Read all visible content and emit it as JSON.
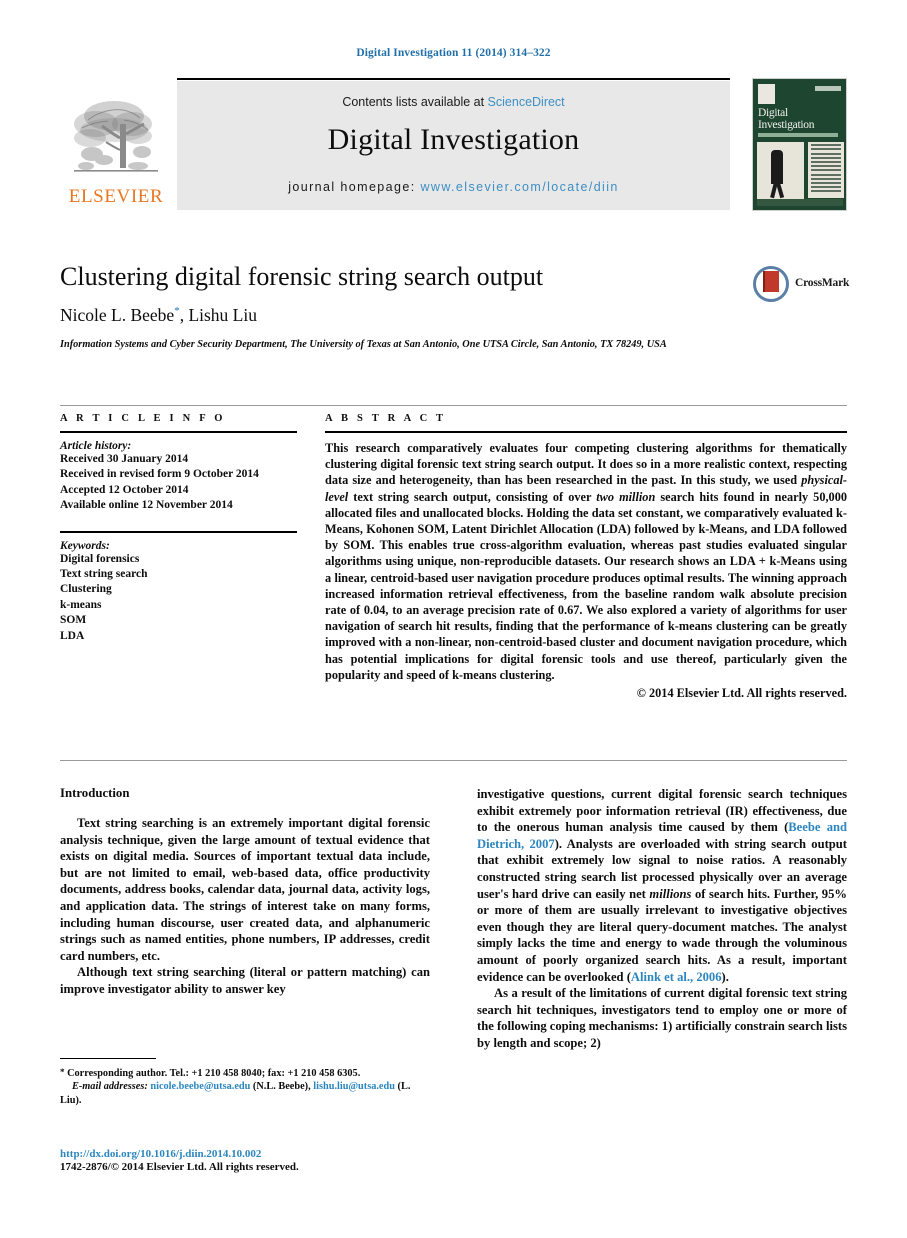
{
  "running_head": "Digital Investigation 11 (2014) 314–322",
  "masthead": {
    "contents_prefix": "Contents lists available at ",
    "sciencedirect": "ScienceDirect",
    "journal_title": "Digital Investigation",
    "homepage_prefix": "journal homepage: ",
    "homepage_url": "www.elsevier.com/locate/diin",
    "publisher": "ELSEVIER",
    "cover_title": "Digital Investigation"
  },
  "article": {
    "title": "Clustering digital forensic string search output",
    "authors": "Nicole L. Beebe",
    "author_marker": "*",
    "authors_rest": ", Lishu Liu",
    "affiliation": "Information Systems and Cyber Security Department, The University of Texas at San Antonio, One UTSA Circle, San Antonio, TX 78249, USA",
    "crossmark_label": "CrossMark"
  },
  "info": {
    "heading": "A R T I C L E   I N F O",
    "history_label": "Article history:",
    "history": [
      "Received 30 January 2014",
      "Received in revised form 9 October 2014",
      "Accepted 12 October 2014",
      "Available online 12 November 2014"
    ],
    "keywords_label": "Keywords:",
    "keywords": [
      "Digital forensics",
      "Text string search",
      "Clustering",
      "k-means",
      "SOM",
      "LDA"
    ]
  },
  "abstract": {
    "heading": "A B S T R A C T",
    "part1": "This research comparatively evaluates four competing clustering algorithms for thematically clustering digital forensic text string search output. It does so in a more realistic context, respecting data size and heterogeneity, than has been researched in the past. In this study, we used ",
    "em1": "physical-level",
    "part2": " text string search output, consisting of over ",
    "em2": "two million",
    "part3": " search hits found in nearly 50,000 allocated files and unallocated blocks. Holding the data set constant, we comparatively evaluated k-Means, Kohonen SOM, Latent Dirichlet Allocation (LDA) followed by k-Means, and LDA followed by SOM. This enables true cross-algorithm evaluation, whereas past studies evaluated singular algorithms using unique, non-reproducible datasets. Our research shows an LDA + k-Means using a linear, centroid-based user navigation procedure produces optimal results. The winning approach increased information retrieval effectiveness, from the baseline random walk absolute precision rate of 0.04, to an average precision rate of 0.67. We also explored a variety of algorithms for user navigation of search hit results, finding that the performance of k-means clustering can be greatly improved with a non-linear, non-centroid-based cluster and document navigation procedure, which has potential implications for digital forensic tools and use thereof, particularly given the popularity and speed of k-means clustering.",
    "copyright": "© 2014 Elsevier Ltd. All rights reserved."
  },
  "body": {
    "intro_heading": "Introduction",
    "left_p1": "Text string searching is an extremely important digital forensic analysis technique, given the large amount of textual evidence that exists on digital media. Sources of important textual data include, but are not limited to email, web-based data, office productivity documents, address books, calendar data, journal data, activity logs, and application data. The strings of interest take on many forms, including human discourse, user created data, and alphanumeric strings such as named entities, phone numbers, IP addresses, credit card numbers, etc.",
    "left_p2": "Although text string searching (literal or pattern matching) can improve investigator ability to answer key",
    "right_p1a": "investigative questions, current digital forensic search techniques exhibit extremely poor information retrieval (IR) effectiveness, due to the onerous human analysis time caused by them (",
    "right_ref1": "Beebe and Dietrich, 2007",
    "right_p1b": "). Analysts are overloaded with string search output that exhibit extremely low signal to noise ratios. A reasonably constructed string search list processed physically over an average user's hard drive can easily net ",
    "right_em1": "millions",
    "right_p1c": " of search hits. Further, 95% or more of them are usually irrelevant to investigative objectives even though they are literal query-document matches. The analyst simply lacks the time and energy to wade through the voluminous amount of poorly organized search hits. As a result, important evidence can be overlooked (",
    "right_ref2": "Alink et al., 2006",
    "right_p1d": ").",
    "right_p2": "As a result of the limitations of current digital forensic text string search hit techniques, investigators tend to employ one or more of the following coping mechanisms: 1) artificially constrain search lists by length and scope; 2)"
  },
  "footnote": {
    "star": "*",
    "corresponding": " Corresponding author. Tel.: +1 210 458 8040; fax: +1 210 458 6305.",
    "email_label": "E-mail addresses:",
    "email1": "nicole.beebe@utsa.edu",
    "email1_owner": " (N.L. Beebe), ",
    "email2": "lishu.liu@utsa.edu",
    "email2_owner": " (L. Liu)."
  },
  "imprint": {
    "doi": "http://dx.doi.org/10.1016/j.diin.2014.10.002",
    "issn": "1742-2876/© 2014 Elsevier Ltd. All rights reserved."
  },
  "colors": {
    "link_blue": "#2b86bf",
    "header_blue": "#1f6fa8",
    "elsevier_orange": "#E87722",
    "cover_green": "#1d4530"
  }
}
